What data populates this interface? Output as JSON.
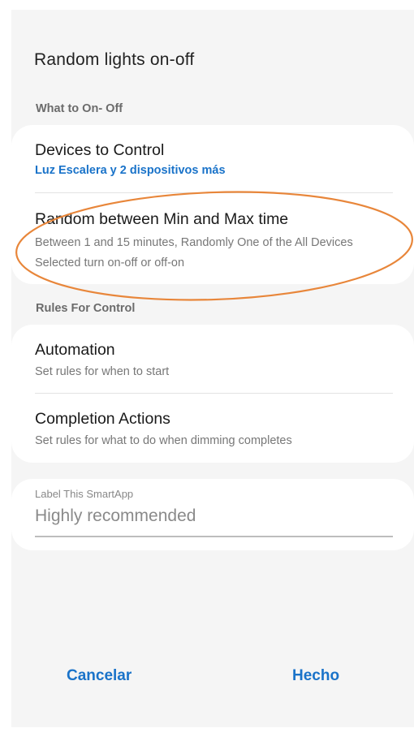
{
  "screen": {
    "title": "Random lights on-off"
  },
  "sections": {
    "what": {
      "header": "What to On- Off"
    },
    "rules": {
      "header": "Rules For Control"
    }
  },
  "devices": {
    "title": "Devices to Control",
    "subtitle": "Luz Escalera y 2 dispositivos más"
  },
  "random": {
    "title": "Random between Min and Max time",
    "subtitle": "Between 1 and 15 minutes, Randomly One of the All Devices Selected turn on-off or off-on"
  },
  "automation": {
    "title": "Automation",
    "subtitle": "Set rules for when to start"
  },
  "completion": {
    "title": "Completion Actions",
    "subtitle": "Set rules for what to do when dimming completes"
  },
  "label_field": {
    "label": "Label This SmartApp",
    "value": "Highly recommended"
  },
  "footer": {
    "cancel_label": "Cancelar",
    "done_label": "Hecho"
  },
  "colors": {
    "background": "#f5f5f5",
    "card": "#ffffff",
    "accent": "#1a73c9",
    "annotation": "#e8863a"
  }
}
